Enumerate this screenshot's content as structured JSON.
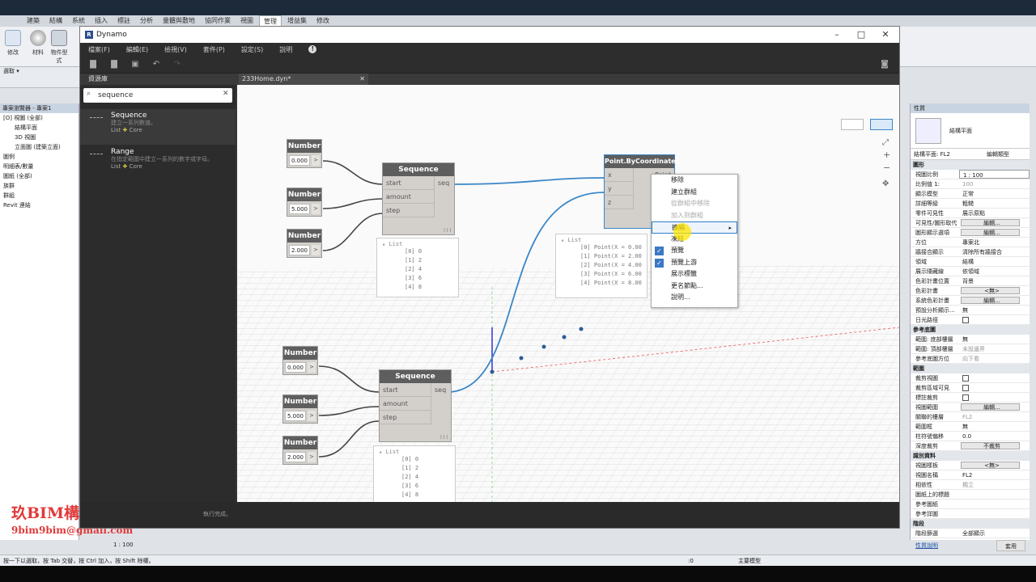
{
  "revit": {
    "ribbon_tabs": [
      "建築",
      "結構",
      "系統",
      "插入",
      "標註",
      "分析",
      "量體與敷地",
      "協同作業",
      "視圖",
      "管理",
      "增益集",
      "修改"
    ],
    "active_tab": "管理",
    "ribbon_buttons": [
      "修改",
      "材料",
      "物件型式"
    ],
    "select_label": "選取",
    "browser_title": "專案瀏覽器 - 專案1",
    "browser_tree": [
      "[O] 視圖 (全部)",
      "結構平面",
      "3D 視圖",
      "立面圖 (建築立面)",
      "圖例",
      "明細表/數量",
      "圖紙 (全部)",
      "族群",
      "群組",
      "Revit 連結"
    ],
    "properties_title": "性質",
    "type_name": "結構平面",
    "view_selector": "結構平面: FL2",
    "edit_type": "編輯類型",
    "sections": {
      "graphics": "圖形",
      "underlay": "參考底圖",
      "extents": "範圍",
      "identity": "識別資料",
      "phasing": "階段"
    },
    "graphics_rows": [
      {
        "k": "視圖比例",
        "v": "1 : 100",
        "style": "input"
      },
      {
        "k": "比例值 1:",
        "v": "100",
        "style": "grey"
      },
      {
        "k": "顯示模型",
        "v": "正常",
        "style": ""
      },
      {
        "k": "詳細等級",
        "v": "粗糙",
        "style": ""
      },
      {
        "k": "零件可見性",
        "v": "展示原點",
        "style": ""
      },
      {
        "k": "可見性/圖形取代",
        "v": "編輯...",
        "style": "btn"
      },
      {
        "k": "圖形顯示選項",
        "v": "編輯...",
        "style": "btn"
      },
      {
        "k": "方位",
        "v": "專案北",
        "style": ""
      },
      {
        "k": "牆接合顯示",
        "v": "清除所有牆接合",
        "style": ""
      },
      {
        "k": "領域",
        "v": "結構",
        "style": ""
      },
      {
        "k": "展示隱藏線",
        "v": "依領域",
        "style": ""
      },
      {
        "k": "色彩計畫位置",
        "v": "背景",
        "style": ""
      },
      {
        "k": "色彩計畫",
        "v": "<無>",
        "style": "btn"
      },
      {
        "k": "系統色彩計畫",
        "v": "編輯...",
        "style": "btn"
      },
      {
        "k": "預設分析顯示...",
        "v": "無",
        "style": ""
      },
      {
        "k": "日光路徑",
        "v": "",
        "style": "check"
      }
    ],
    "underlay_rows": [
      {
        "k": "範圍: 底部樓層",
        "v": "無",
        "style": ""
      },
      {
        "k": "範圍: 頂部樓層",
        "v": "未設邊界",
        "style": "grey"
      },
      {
        "k": "參考底圖方位",
        "v": "向下看",
        "style": "grey"
      }
    ],
    "extents_rows": [
      {
        "k": "裁剪視圖",
        "v": "",
        "style": "check"
      },
      {
        "k": "裁剪區域可見",
        "v": "",
        "style": "check"
      },
      {
        "k": "標註裁剪",
        "v": "",
        "style": "check"
      },
      {
        "k": "視圖範圍",
        "v": "編輯...",
        "style": "btn"
      },
      {
        "k": "關聯的樓層",
        "v": "FL2",
        "style": "grey"
      },
      {
        "k": "範圍框",
        "v": "無",
        "style": ""
      },
      {
        "k": "柱符號偏移",
        "v": "0.0",
        "style": ""
      },
      {
        "k": "深度裁剪",
        "v": "不裁剪",
        "style": "btn"
      }
    ],
    "identity_rows": [
      {
        "k": "視圖樣板",
        "v": "<無>",
        "style": "btn"
      },
      {
        "k": "視圖名稱",
        "v": "FL2",
        "style": ""
      },
      {
        "k": "相依性",
        "v": "獨立",
        "style": "grey"
      },
      {
        "k": "圖紙上的標題",
        "v": "",
        "style": ""
      },
      {
        "k": "參考圖紙",
        "v": "",
        "style": "grey"
      },
      {
        "k": "參考詳圖",
        "v": "",
        "style": "grey"
      }
    ],
    "phasing_rows": [
      {
        "k": "階段篩選",
        "v": "全部顯示",
        "style": ""
      }
    ],
    "props_help": "性質說明",
    "apply_label": "套用",
    "view_scale": "1 : 100",
    "status_text": "按一下以選取，按 Tab 交替，按 Ctrl 加入，按 Shift 除權。",
    "model_label": "主要模型",
    "zero": ":0"
  },
  "watermark": {
    "line1": "玖BIM構創會盟",
    "line2": "9bim9bim@gmail.com"
  },
  "dynamo": {
    "title": "Dynamo",
    "menu": [
      "檔案(F)",
      "編輯(E)",
      "檢視(V)",
      "套件(P)",
      "設定(S)",
      "說明"
    ],
    "library_header": "資源庫",
    "search_value": "sequence",
    "library_items": [
      {
        "name": "Sequence",
        "desc": "建立一系列數值。",
        "cat": "List",
        "core": "Core"
      },
      {
        "name": "Range",
        "desc": "在指定範圍中建立一系列的數字或字母。",
        "cat": "List",
        "core": "Core"
      }
    ],
    "workspace_tab": "233Home.dyn*",
    "status": "執行完成。",
    "nodes": {
      "number_title": "Number",
      "n1": "0.000",
      "n2": "5.000",
      "n3": "2.000",
      "n4": "0.000",
      "n5": "5.000",
      "n6": "2.000",
      "seq_title": "Sequence",
      "seq_inputs": [
        "start",
        "amount",
        "step"
      ],
      "seq_output": "seq",
      "lacing": "l l l",
      "point_title": "Point.ByCoordinates",
      "point_inputs": [
        "x",
        "y",
        "z"
      ],
      "point_output": "Point"
    },
    "list_preview": {
      "title": "List",
      "rows": [
        "[0] 0",
        "[1] 2",
        "[2] 4",
        "[3] 6",
        "[4] 8"
      ]
    },
    "point_preview": {
      "title": "List",
      "rows": [
        "[0] Point(X = 0.00",
        "[1] Point(X = 2.00",
        "[2] Point(X = 4.00",
        "[3] Point(X = 6.00",
        "[4] Point(X = 8.00"
      ]
    },
    "context_menu": [
      {
        "label": "移除",
        "state": ""
      },
      {
        "label": "建立群組",
        "state": ""
      },
      {
        "label": "從群組中移除",
        "state": "disabled"
      },
      {
        "label": "加入到群組",
        "state": "disabled"
      },
      {
        "label": "擴編",
        "state": "hover"
      },
      {
        "label": "凍結",
        "state": ""
      },
      {
        "label": "預覽",
        "state": "checked"
      },
      {
        "label": "預覽上游",
        "state": "checked"
      },
      {
        "label": "展示標籤",
        "state": ""
      },
      {
        "label": "更名節點...",
        "state": ""
      },
      {
        "label": "說明...",
        "state": ""
      }
    ]
  }
}
